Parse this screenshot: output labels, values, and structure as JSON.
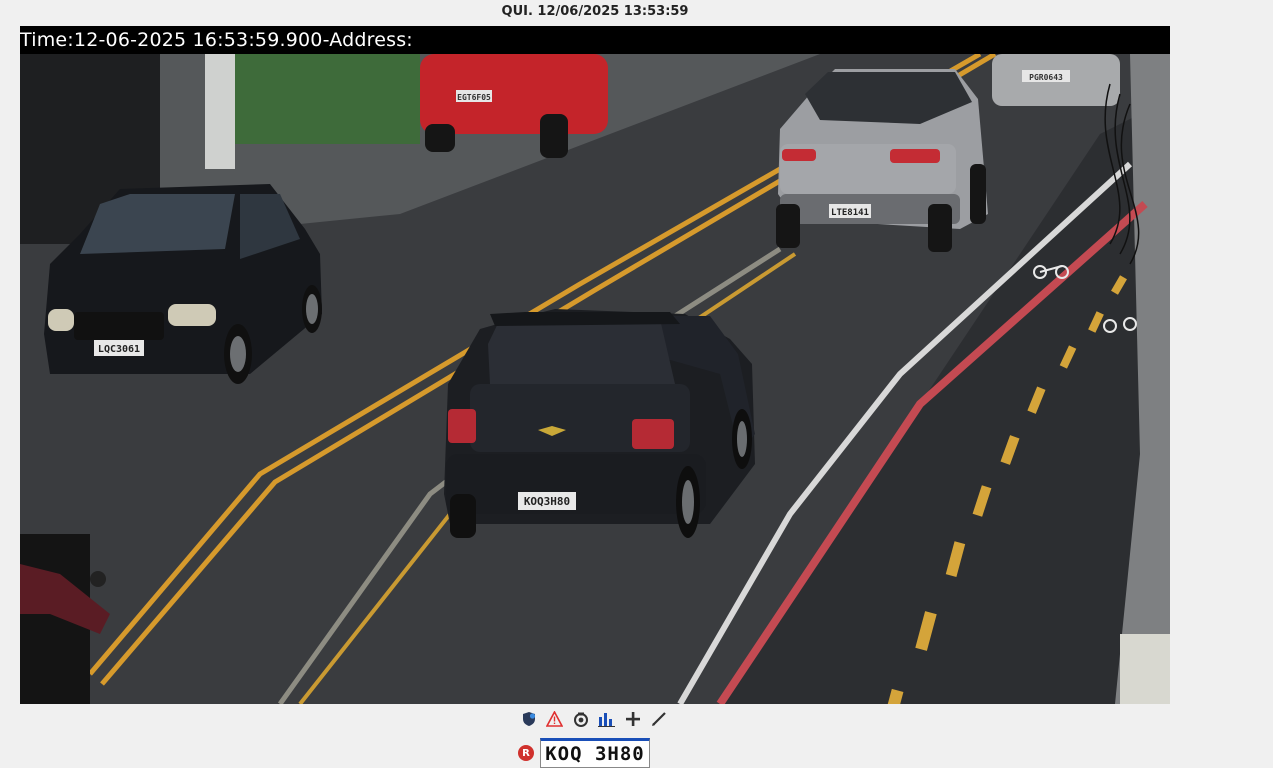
{
  "header": {
    "datetime": "QUI. 12/06/2025 13:53:59"
  },
  "video": {
    "overlay_text": "Time:12-06-2025 16:53:59.900-Address:",
    "plates": {
      "center_car": "KOQ3H80",
      "left_car": "LQC3061",
      "silver_car": "LTE8141",
      "red_car": "EGT6F05",
      "top_right_car": "PGR0643"
    }
  },
  "toolbar": {
    "icons": [
      "shield-heart-icon",
      "warning-icon",
      "camera-icon",
      "bar-chart-icon",
      "plus-icon",
      "pen-icon"
    ],
    "colors": {
      "warning": "#e03030",
      "chart": "#1a4fb8",
      "dark": "#333333"
    }
  },
  "plate_reading": {
    "badge": "R",
    "value": "KOQ 3H80"
  }
}
